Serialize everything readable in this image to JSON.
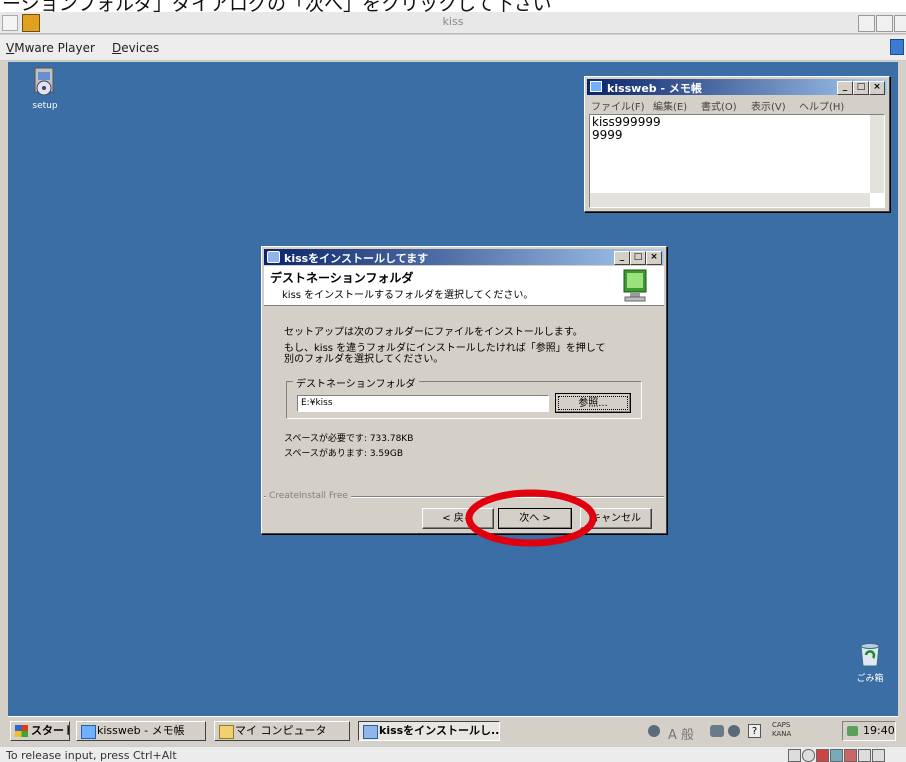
{
  "caption_text": "ーションフォルダ」ダイアログの「次へ」をクリックして下さい",
  "host": {
    "title": "kiss",
    "menu": [
      {
        "label": "VMware Player",
        "underline": "V",
        "rest": "Mware Player"
      },
      {
        "label": "Devices",
        "underline": "D",
        "rest": "evices"
      }
    ],
    "status_text": "To release input, press Ctrl+Alt"
  },
  "desktop": {
    "icons": [
      {
        "label": "setup"
      },
      {
        "label": "ごみ箱"
      }
    ]
  },
  "notepad": {
    "title": "kissweb - メモ帳",
    "menu": [
      "ファイル(F)",
      "編集(E)",
      "書式(O)",
      "表示(V)",
      "ヘルプ(H)"
    ],
    "lines": [
      "kiss999999",
      "9999"
    ]
  },
  "installer": {
    "title": "kissをインストールしてます",
    "header_title": "デストネーションフォルダ",
    "header_sub": "kiss をインストールするフォルダを選択してください。",
    "text1": "セットアップは次のフォルダーにファイルをインストールします。",
    "text2a": "もし、kiss を違うフォルダにインストールしたければ「参照」を押して",
    "text2b": "別のフォルダを選択してください。",
    "group_label": "デストネーションフォルダ",
    "path_value": "E:¥kiss",
    "browse_label": "参照...",
    "space_required": "スペースが必要です: 733.78KB",
    "space_available": "スペースがあります: 3.59GB",
    "footer_label": "CreateInstall Free",
    "back_label": "< 戻る",
    "next_label": "次へ >",
    "cancel_label": "キャンセル"
  },
  "taskbar": {
    "start_label": "スタート",
    "items": [
      {
        "label": "kissweb - メモ帳"
      },
      {
        "label": "マイ コンピュータ"
      },
      {
        "label": "kissをインストールし..."
      }
    ],
    "ime_text": "A 般",
    "caps_label": "CAPS",
    "kana_label": "KANA",
    "clock": "19:40"
  },
  "colors": {
    "desktop": "#3a6ea5",
    "titlebar_start": "#0a246a",
    "titlebar_end": "#a6caf0",
    "annotation": "#e0000f"
  },
  "annotation": {
    "type": "red-ellipse",
    "target": "next-button"
  }
}
